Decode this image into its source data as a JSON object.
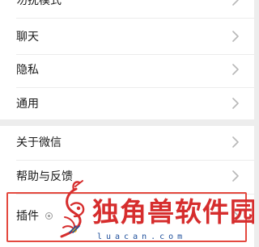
{
  "settings": {
    "items": [
      {
        "label": "勿扰模式"
      },
      {
        "label": "聊天"
      },
      {
        "label": "隐私"
      },
      {
        "label": "通用"
      },
      {
        "label": "关于微信"
      },
      {
        "label": "帮助与反馈"
      },
      {
        "label": "插件"
      }
    ]
  },
  "watermark": {
    "title": "独角兽软件园",
    "domain": "luacan.com",
    "colors": {
      "title": "#d62d2d",
      "domain": "#1e4f9b"
    }
  },
  "highlight": {
    "color": "#e4493f"
  }
}
